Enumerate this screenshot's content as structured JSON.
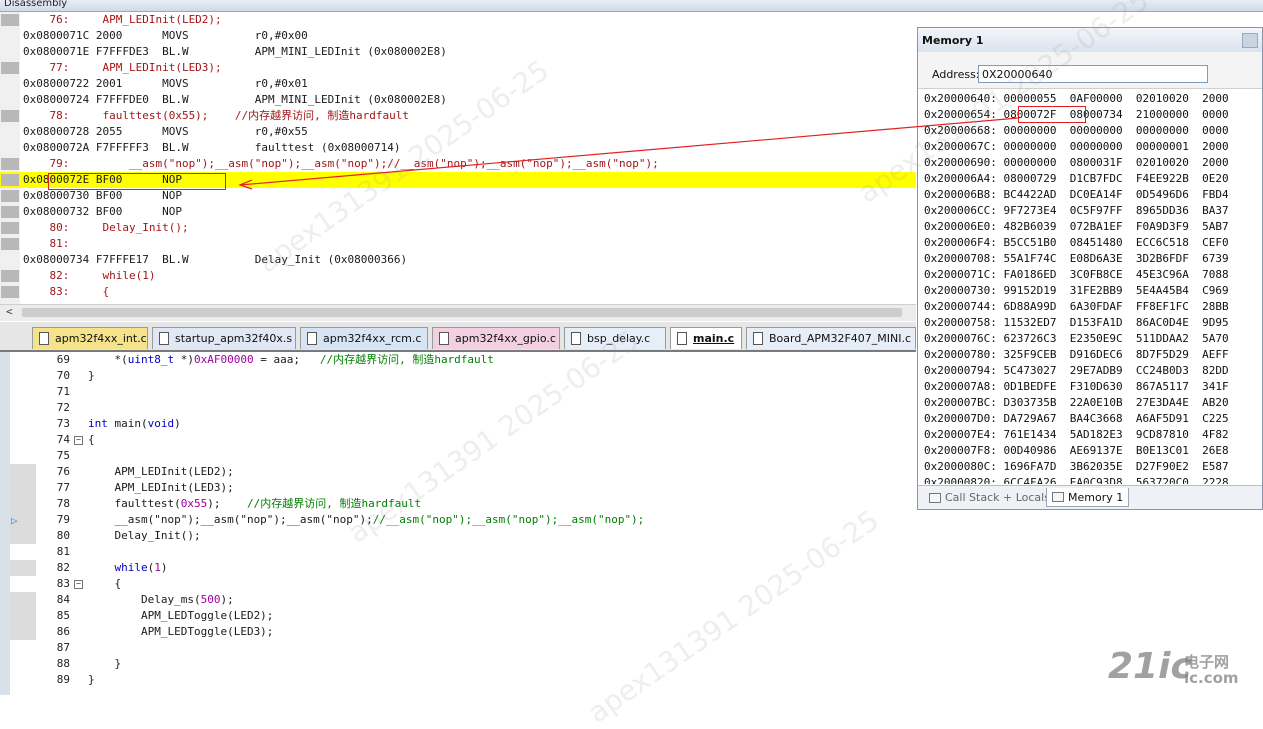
{
  "disassembly": {
    "title": "Disassembly",
    "lines": [
      {
        "kind": "src",
        "text": "    76:     APM_LEDInit(LED2);",
        "bar": true
      },
      {
        "kind": "asm",
        "text": "0x0800071C 2000      MOVS          r0,#0x00"
      },
      {
        "kind": "asm",
        "text": "0x0800071E F7FFFDE3  BL.W          APM_MINI_LEDInit (0x080002E8)"
      },
      {
        "kind": "src",
        "text": "    77:     APM_LEDInit(LED3);",
        "bar": true
      },
      {
        "kind": "asm",
        "text": "0x08000722 2001      MOVS          r0,#0x01"
      },
      {
        "kind": "asm",
        "text": "0x08000724 F7FFFDE0  BL.W          APM_MINI_LEDInit (0x080002E8)"
      },
      {
        "kind": "src",
        "text": "    78:     faulttest(0x55);    //内存越界访问, 制造hardfault",
        "bar": true
      },
      {
        "kind": "asm",
        "text": "0x08000728 2055      MOVS          r0,#0x55"
      },
      {
        "kind": "asm",
        "text": "0x0800072A F7FFFFF3  BL.W          faulttest (0x08000714)"
      },
      {
        "kind": "src",
        "text": "    79:         __asm(\"nop\");__asm(\"nop\");__asm(\"nop\");//__asm(\"nop\");__asm(\"nop\");__asm(\"nop\");",
        "bar": true
      },
      {
        "kind": "asm",
        "text": "0x0800072E BF00      NOP",
        "highlight": true,
        "bar": true
      },
      {
        "kind": "asm",
        "text": "0x08000730 BF00      NOP",
        "bar": true
      },
      {
        "kind": "asm",
        "text": "0x08000732 BF00      NOP",
        "bar": true
      },
      {
        "kind": "src",
        "text": "    80:     Delay_Init();",
        "bar": true
      },
      {
        "kind": "src",
        "text": "    81:",
        "bar": true
      },
      {
        "kind": "asm",
        "text": "0x08000734 F7FFFE17  BL.W          Delay_Init (0x08000366)"
      },
      {
        "kind": "src",
        "text": "    82:     while(1)",
        "bar": true
      },
      {
        "kind": "src",
        "text": "    83:     {",
        "bar": true
      }
    ],
    "scroll_left_glyph": "<"
  },
  "tabs": [
    {
      "label": "apm32f4xx_int.c",
      "color": "#f4e38a",
      "active": false
    },
    {
      "label": "startup_apm32f40x.s",
      "color": "#dfe8f4",
      "active": false
    },
    {
      "label": "apm32f4xx_rcm.c",
      "color": "#d6e4f4",
      "active": false
    },
    {
      "label": "apm32f4xx_gpio.c",
      "color": "#f2d0e0",
      "active": false
    },
    {
      "label": "bsp_delay.c",
      "color": "#e6eef8",
      "active": false
    },
    {
      "label": "main.c",
      "color": "#ffffff",
      "active": true
    },
    {
      "label": "Board_APM32F407_MINI.c",
      "color": "#e6eef8",
      "active": false
    }
  ],
  "editor": {
    "lines": [
      {
        "num": "69",
        "code": "    *(uint8_t *)0xAF00000 = aaa;   //内存越界访问, 制造hardfault",
        "mark": false
      },
      {
        "num": "70",
        "code": "}",
        "mark": false
      },
      {
        "num": "71",
        "code": "",
        "mark": false
      },
      {
        "num": "72",
        "code": "",
        "mark": false
      },
      {
        "num": "73",
        "code": "int main(void)",
        "mark": false
      },
      {
        "num": "74",
        "code": "{",
        "mark": false,
        "fold": "−"
      },
      {
        "num": "75",
        "code": "",
        "mark": false
      },
      {
        "num": "76",
        "code": "    APM_LEDInit(LED2);",
        "mark": true
      },
      {
        "num": "77",
        "code": "    APM_LEDInit(LED3);",
        "mark": true
      },
      {
        "num": "78",
        "code": "    faulttest(0x55);    //内存越界访问, 制造hardfault",
        "mark": true
      },
      {
        "num": "79",
        "code": "    __asm(\"nop\");__asm(\"nop\");__asm(\"nop\");//__asm(\"nop\");__asm(\"nop\");__asm(\"nop\");",
        "mark": true
      },
      {
        "num": "80",
        "code": "    Delay_Init();",
        "mark": true
      },
      {
        "num": "81",
        "code": "",
        "mark": false
      },
      {
        "num": "82",
        "code": "    while(1)",
        "mark": true
      },
      {
        "num": "83",
        "code": "    {",
        "mark": false,
        "fold": "−"
      },
      {
        "num": "84",
        "code": "        Delay_ms(500);",
        "mark": true
      },
      {
        "num": "85",
        "code": "        APM_LEDToggle(LED2);",
        "mark": true
      },
      {
        "num": "86",
        "code": "        APM_LEDToggle(LED3);",
        "mark": true
      },
      {
        "num": "87",
        "code": "",
        "mark": false
      },
      {
        "num": "88",
        "code": "    }",
        "mark": false
      },
      {
        "num": "89",
        "code": "}",
        "mark": false
      }
    ],
    "exec_line": "79"
  },
  "memory": {
    "title": "Memory 1",
    "address_label": "Address:",
    "address_value": "0X20000640",
    "rows": [
      "0x20000640: 00000055  0AF00000  02010020  2000",
      "0x20000654: 0800072F  08000734  21000000  0000",
      "0x20000668: 00000000  00000000  00000000  0000",
      "0x2000067C: 00000000  00000000  00000001  2000",
      "0x20000690: 00000000  0800031F  02010020  2000",
      "0x200006A4: 08000729  D1CB7FDC  F4EE922B  0E20",
      "0x200006B8: BC4422AD  DC0EA14F  0D5496D6  FBD4",
      "0x200006CC: 9F7273E4  0C5F97FF  8965DD36  BA37",
      "0x200006E0: 482B6039  072BA1EF  F0A9D3F9  5AB7",
      "0x200006F4: B5CC51B0  08451480  ECC6C518  CEF0",
      "0x20000708: 55A1F74C  E08D6A3E  3D2B6FDF  6739",
      "0x2000071C: FA0186ED  3C0FB8CE  45E3C96A  7088",
      "0x20000730: 99152D19  31FE2BB9  5E4A45B4  C969",
      "0x20000744: 6D88A99D  6A30FDAF  FF8EF1FC  28BB",
      "0x20000758: 11532ED7  D153FA1D  86AC0D4E  9D95",
      "0x2000076C: 623726C3  E2350E9C  511DDAA2  5A70",
      "0x20000780: 325F9CEB  D916DEC6  8D7F5D29  AEFF",
      "0x20000794: 5C473027  29E7ADB9  CC24B0D3  82DD",
      "0x200007A8: 0D1BEDFE  F310D630  867A5117  341F",
      "0x200007BC: D303735B  22A0E10B  27E3DA4E  AB20",
      "0x200007D0: DA729A67  BA4C3668  A6AF5D91  C225",
      "0x200007E4: 761E1434  5AD182E3  9CD87810  4F82",
      "0x200007F8: 00D40986  AE69137E  B0E13C01  26E8",
      "0x2000080C: 1696FA7D  3B62035E  D27F90E2  E587",
      "0x20000820: 6CC4FA26  EA0C93D8  563720C0  2228"
    ],
    "bottom_tabs": [
      {
        "label": "Call Stack + Locals",
        "active": false
      },
      {
        "label": "Memory 1",
        "active": true
      }
    ]
  },
  "watermarks": [
    {
      "text": "apex131391 2025-06-25"
    },
    {
      "text": "apex131391 2025-06-25"
    },
    {
      "text": "apex131391 2025-06-25"
    },
    {
      "text": "apex131391 2025-06-25"
    }
  ],
  "logo": {
    "big": "21ic",
    "small_line1": "电子网",
    "small_line2": "ic.com"
  },
  "colors": {
    "highlight": "#ffff00",
    "annotation": "#e02020",
    "comment": "#008000",
    "keyword": "#0000c0"
  }
}
